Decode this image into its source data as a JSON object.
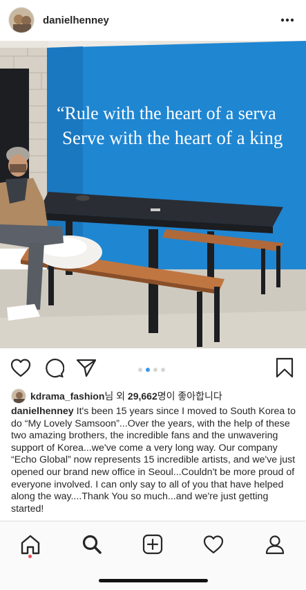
{
  "post": {
    "username": "danielhenney",
    "more_icon": "more-horizontal-icon"
  },
  "photo": {
    "wall_quote_line1": "“Rule with the heart of a serva",
    "wall_quote_line2": "Serve with the heart of a king"
  },
  "actions": {
    "like_icon": "heart-icon",
    "comment_icon": "comment-icon",
    "share_icon": "paper-plane-icon",
    "save_icon": "bookmark-icon",
    "carousel_total": 4,
    "carousel_active_index": 1
  },
  "likes": {
    "user": "kdrama_fashion",
    "suffix_before": "님 외 ",
    "count": "29,662",
    "suffix_after": "명이 좋아합니다"
  },
  "caption": {
    "username": "danielhenney",
    "text": "It's been 15 years since I moved to South Korea to do “My Lovely Samsoon”...Over the years, with the help of these two amazing brothers, the incredible fans and the unwavering support of Korea...we've come a very long way.  Our company “Echo Global” now represents 15 incredible artists, and we've just opened our brand new office in Seoul...Couldn't be more proud of everyone involved.  I can only say to all of you that have helped along the way....Thank You so much...and we're just getting started!"
  },
  "nav": {
    "items": [
      "home-icon",
      "search-icon",
      "add-post-icon",
      "activity-heart-icon",
      "profile-icon"
    ],
    "active": "home",
    "accent_color": "#ed4956"
  }
}
